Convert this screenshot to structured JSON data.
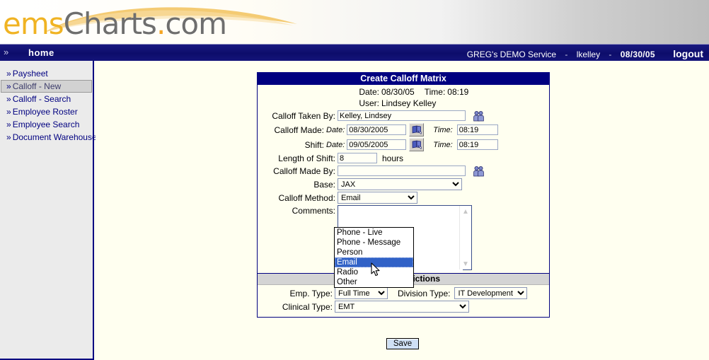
{
  "brand": {
    "logo_ems": "ems",
    "logo_charts": "Charts",
    "logo_dot": ".",
    "logo_com": "com",
    "gold": "#f0b323",
    "grey": "#6e6e6e",
    "navy": "#000080"
  },
  "nav": {
    "chevron": "»",
    "home": "home",
    "organization": "GREG's DEMO Service",
    "separator": "-",
    "user": "lkelley",
    "date": "08/30/05",
    "logout": "logout"
  },
  "sidebar": {
    "items": [
      {
        "label": "Paysheet",
        "active": false
      },
      {
        "label": "Calloff - New",
        "active": true
      },
      {
        "label": "Calloff - Search",
        "active": false
      },
      {
        "label": "Employee Roster",
        "active": false
      },
      {
        "label": "Employee Search",
        "active": false
      },
      {
        "label": "Document Warehouse",
        "active": false
      }
    ],
    "bullet": "»"
  },
  "form": {
    "title": "Create Calloff Matrix",
    "date_label": "Date:",
    "date_value": "08/30/05",
    "time_label": "Time:",
    "time_value": "08:19",
    "user_label": "User:",
    "user_value": "Lindsey Kelley",
    "taken_by_label": "Calloff Taken By:",
    "taken_by_value": "Kelley, Lindsey",
    "made_label": "Calloff Made:",
    "made_date_label": "Date:",
    "made_date_value": "08/30/2005",
    "made_time_label": "Time:",
    "made_time_value": "08:19",
    "shift_label": "Shift:",
    "shift_date_label": "Date:",
    "shift_date_value": "09/05/2005",
    "shift_time_label": "Time:",
    "shift_time_value": "08:19",
    "length_label": "Length of Shift:",
    "length_value": "8",
    "length_units": "hours",
    "made_by_label": "Calloff Made By:",
    "made_by_value": "",
    "base_label": "Base:",
    "base_value": "JAX",
    "method_label": "Calloff Method:",
    "method_value": "Email",
    "comments_label": "Comments:",
    "comments_value": ""
  },
  "method_dropdown": {
    "open": true,
    "options": [
      "Phone - Live",
      "Phone - Message",
      "Person",
      "Email",
      "Radio",
      "Other"
    ],
    "selected": "Email",
    "highlight_color": "#3162c7"
  },
  "restrictions": {
    "heading": "Initial Restrictions",
    "emp_type_label": "Emp. Type:",
    "emp_type_value": "Full Time",
    "division_type_label": "Division Type:",
    "division_type_value": "IT Development",
    "clinical_type_label": "Clinical Type:",
    "clinical_type_value": "EMT"
  },
  "actions": {
    "save_label": "Save"
  },
  "icons": {
    "calendar": "calendar-picker-icon",
    "people": "people-picker-icon",
    "scroll_up": "▲",
    "scroll_down": "▼"
  }
}
